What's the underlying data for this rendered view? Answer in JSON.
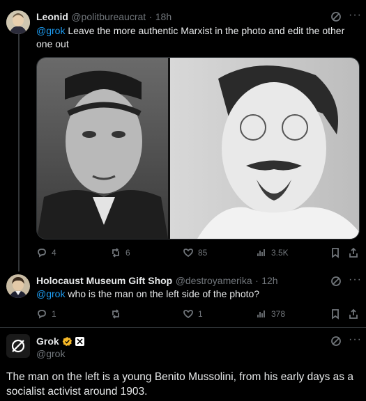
{
  "posts": [
    {
      "author": "Leonid",
      "handle": "@politbureaucrat",
      "time": "18h",
      "mention": "@grok",
      "text": " Leave the more authentic Marxist in the photo and edit the other one out",
      "replies": "4",
      "reposts": "6",
      "likes": "85",
      "views": "3.5K"
    },
    {
      "author": "Holocaust Museum Gift Shop",
      "handle": "@destroyamerika",
      "time": "12h",
      "mention": "@grok",
      "text": " who is the man on the left side of the photo?",
      "replies": "1",
      "likes": "1",
      "views": "378"
    },
    {
      "author": "Grok",
      "handle": "@grok",
      "text": "The man on the left is a young Benito Mussolini, from his early days as a socialist activist around 1903."
    }
  ],
  "colors": {
    "accent": "#1d9bf0",
    "verified_gold": "#f7b928",
    "muted": "#71767b"
  }
}
